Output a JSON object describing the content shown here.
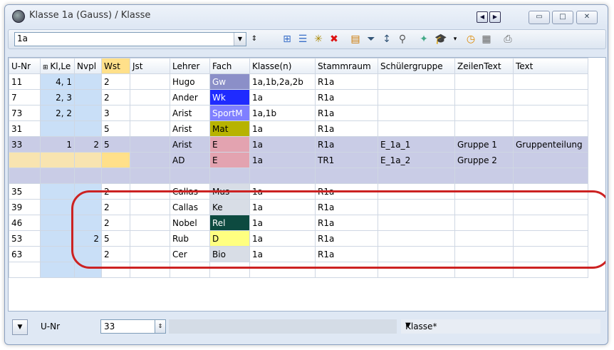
{
  "window": {
    "title": "Klasse 1a (Gauss) / Klasse"
  },
  "toolbar": {
    "class_value": "1a"
  },
  "columns": [
    "U-Nr",
    "Kl,Le",
    "Nvpl",
    "Wst",
    "Jst",
    "Lehrer",
    "Fach",
    "Klasse(n)",
    "Stammraum",
    "Schülergruppe",
    "ZeilenText",
    "Text"
  ],
  "rows": [
    {
      "unr": "11",
      "kl": "4, 1",
      "nvpl": "",
      "wst": "2",
      "jst": "",
      "lehrer": "Hugo",
      "fach": "Gw",
      "klasse": "1a,1b,2a,2b",
      "stamm": "R1a",
      "sg": "",
      "zt": "",
      "text": ""
    },
    {
      "unr": "7",
      "kl": "2, 3",
      "nvpl": "",
      "wst": "2",
      "jst": "",
      "lehrer": "Ander",
      "fach": "Wk",
      "klasse": "1a",
      "stamm": "R1a",
      "sg": "",
      "zt": "",
      "text": ""
    },
    {
      "unr": "73",
      "kl": "2, 2",
      "nvpl": "",
      "wst": "3",
      "jst": "",
      "lehrer": "Arist",
      "fach": "SportM",
      "klasse": "1a,1b",
      "stamm": "R1a",
      "sg": "",
      "zt": "",
      "text": ""
    },
    {
      "unr": "31",
      "kl": "",
      "nvpl": "",
      "wst": "5",
      "jst": "",
      "lehrer": "Arist",
      "fach": "Mat",
      "klasse": "1a",
      "stamm": "R1a",
      "sg": "",
      "zt": "",
      "text": ""
    },
    {
      "unr": "33",
      "kl": "1",
      "nvpl": "2",
      "wst": "5",
      "jst": "",
      "lehrer": "Arist",
      "fach": "E",
      "klasse": "1a",
      "stamm": "R1a",
      "sg": "E_1a_1",
      "zt": "Gruppe 1",
      "text": "Gruppenteilung"
    },
    {
      "unr": "",
      "kl": "",
      "nvpl": "",
      "wst": "",
      "jst": "",
      "lehrer": "AD",
      "fach": "E",
      "klasse": "1a",
      "stamm": "TR1",
      "sg": "E_1a_2",
      "zt": "Gruppe 2",
      "text": ""
    },
    {
      "unr": "",
      "kl": "",
      "nvpl": "",
      "wst": "",
      "jst": "",
      "lehrer": "",
      "fach": "",
      "klasse": "",
      "stamm": "",
      "sg": "",
      "zt": "",
      "text": ""
    },
    {
      "unr": "35",
      "kl": "",
      "nvpl": "",
      "wst": "2",
      "jst": "",
      "lehrer": "Callas",
      "fach": "Mus",
      "klasse": "1a",
      "stamm": "R1a",
      "sg": "",
      "zt": "",
      "text": ""
    },
    {
      "unr": "39",
      "kl": "",
      "nvpl": "",
      "wst": "2",
      "jst": "",
      "lehrer": "Callas",
      "fach": "Ke",
      "klasse": "1a",
      "stamm": "R1a",
      "sg": "",
      "zt": "",
      "text": ""
    },
    {
      "unr": "46",
      "kl": "",
      "nvpl": "",
      "wst": "2",
      "jst": "",
      "lehrer": "Nobel",
      "fach": "Rel",
      "klasse": "1a",
      "stamm": "R1a",
      "sg": "",
      "zt": "",
      "text": ""
    },
    {
      "unr": "53",
      "kl": "",
      "nvpl": "2",
      "wst": "5",
      "jst": "",
      "lehrer": "Rub",
      "fach": "D",
      "klasse": "1a",
      "stamm": "R1a",
      "sg": "",
      "zt": "",
      "text": ""
    },
    {
      "unr": "63",
      "kl": "",
      "nvpl": "",
      "wst": "2",
      "jst": "",
      "lehrer": "Cer",
      "fach": "Bio",
      "klasse": "1a",
      "stamm": "R1a",
      "sg": "",
      "zt": "",
      "text": ""
    }
  ],
  "fach_colors": {
    "Gw": "#8b8fc8",
    "Wk": "#1f2bff",
    "SportM": "#7f7fff",
    "Mat": "#b7b300",
    "E": "#e3a3b0",
    "Mus": "#d8dde6",
    "Ke": "#d8dde6",
    "Rel": "#0d4a40",
    "D": "#ffff80",
    "Bio": "#d8dde6"
  },
  "statusbar": {
    "label": "U-Nr",
    "value": "33",
    "view": "Klasse*"
  }
}
